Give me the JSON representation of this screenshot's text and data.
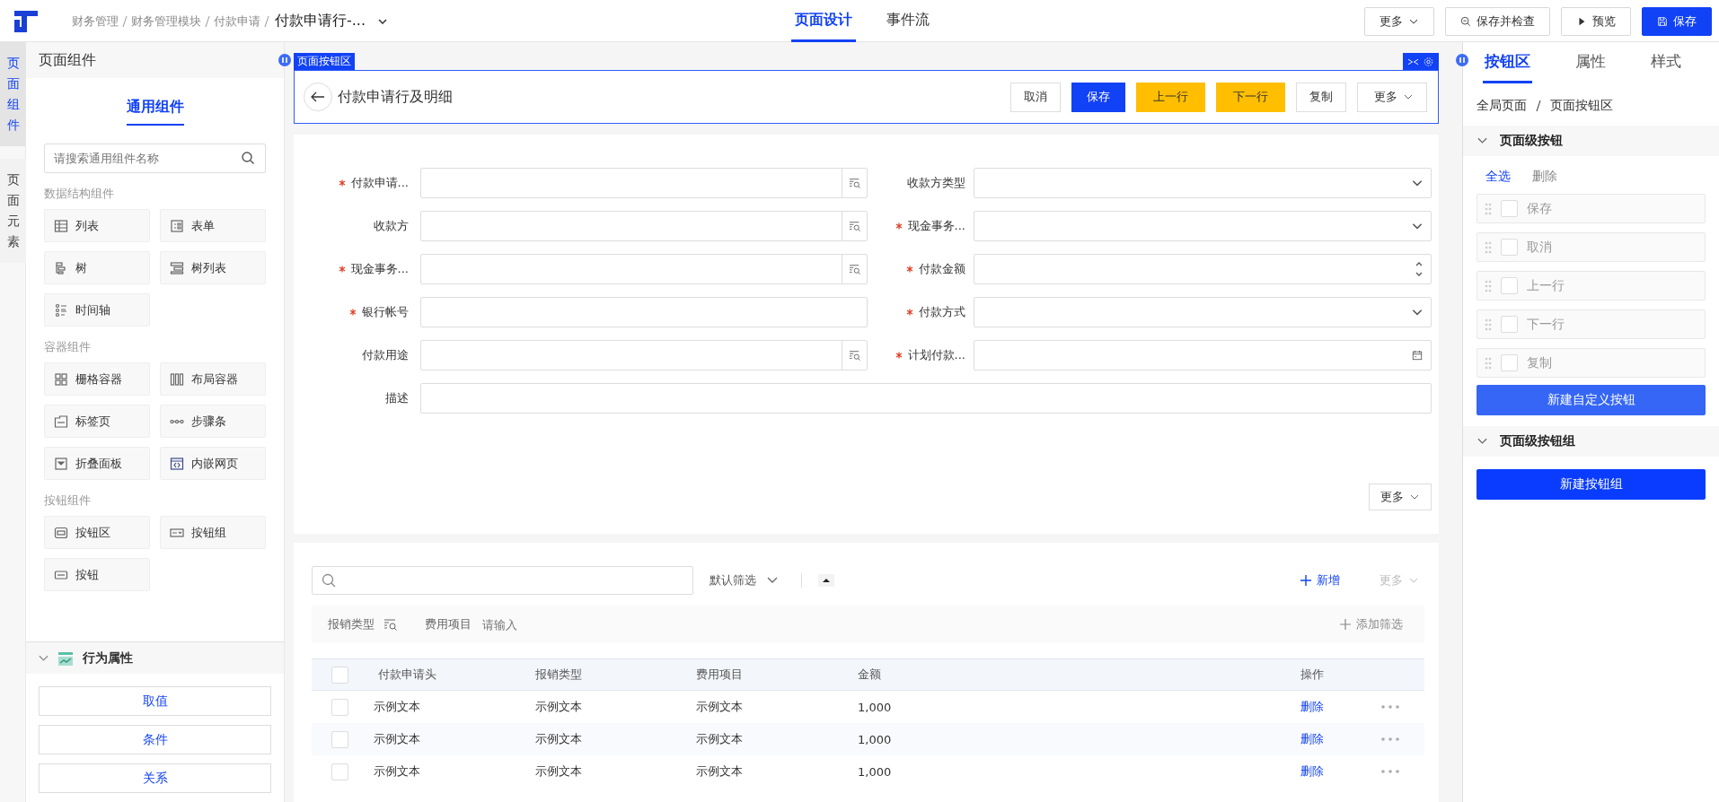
{
  "topbar": {
    "breadcrumbs": [
      "财务管理",
      "财务管理模块",
      "付款申请"
    ],
    "current": "付款申请行-...",
    "tabs": [
      {
        "label": "页面设计",
        "selected": true
      },
      {
        "label": "事件流",
        "selected": false
      }
    ],
    "actions": [
      {
        "label": "更多",
        "kind": "dropdown"
      },
      {
        "label": "保存并检查",
        "kind": "check"
      },
      {
        "label": "预览",
        "kind": "preview"
      },
      {
        "label": "保存",
        "kind": "primary"
      }
    ]
  },
  "side_tabs": [
    {
      "label": "页面组件",
      "selected": true
    },
    {
      "label": "页面元素",
      "selected": false
    }
  ],
  "components_panel": {
    "title": "页面组件",
    "tab": "通用组件",
    "search": {
      "placeholder": "请搜索通用组件名称"
    },
    "groups": [
      {
        "title": "数据结构组件",
        "items": [
          {
            "label": "列表",
            "kind": "table"
          },
          {
            "label": "表单",
            "kind": "form"
          },
          {
            "label": "树",
            "kind": "tree"
          },
          {
            "label": "树列表",
            "kind": "treelist"
          },
          {
            "label": "时间轴",
            "kind": "timeline"
          }
        ]
      },
      {
        "title": "容器组件",
        "items": [
          {
            "label": "栅格容器",
            "kind": "grid"
          },
          {
            "label": "布局容器",
            "kind": "layout"
          },
          {
            "label": "标签页",
            "kind": "tabs"
          },
          {
            "label": "步骤条",
            "kind": "steps"
          },
          {
            "label": "折叠面板",
            "kind": "collapse"
          },
          {
            "label": "内嵌网页",
            "kind": "iframe"
          }
        ]
      },
      {
        "title": "按钮组件",
        "items": [
          {
            "label": "按钮区",
            "kind": "buttonarea"
          },
          {
            "label": "按钮组",
            "kind": "buttongroup"
          },
          {
            "label": "按钮",
            "kind": "button"
          }
        ]
      }
    ]
  },
  "behavior": {
    "title": "行为属性",
    "expanded": true,
    "buttons": [
      "取值",
      "条件",
      "关系"
    ]
  },
  "button_area": {
    "tag": "页面按钮区",
    "title": "付款申请行及明细",
    "buttons": [
      {
        "label": "取消",
        "kind": "default"
      },
      {
        "label": "保存",
        "kind": "primary"
      },
      {
        "label": "上一行",
        "kind": "warning"
      },
      {
        "label": "下一行",
        "kind": "warning"
      },
      {
        "label": "复制",
        "kind": "default"
      },
      {
        "label": "更多",
        "kind": "dropdown"
      }
    ]
  },
  "form": {
    "fields": [
      {
        "label": "付款申请...",
        "required": true,
        "kind": "lookup"
      },
      {
        "label": "收款方类型",
        "required": false,
        "kind": "select"
      },
      {
        "label": "收款方",
        "required": false,
        "kind": "lookup"
      },
      {
        "label": "现金事务...",
        "required": true,
        "kind": "select"
      },
      {
        "label": "现金事务...",
        "required": true,
        "kind": "lookup"
      },
      {
        "label": "付款金额",
        "required": true,
        "kind": "number"
      },
      {
        "label": "银行帐号",
        "required": true,
        "kind": "text"
      },
      {
        "label": "付款方式",
        "required": true,
        "kind": "select"
      },
      {
        "label": "付款用途",
        "required": false,
        "kind": "lookup"
      },
      {
        "label": "计划付款...",
        "required": true,
        "kind": "date"
      },
      {
        "label": "描述",
        "required": false,
        "kind": "wide"
      }
    ],
    "more": "更多"
  },
  "table_section": {
    "filter": "默认筛选",
    "add": "新增",
    "more": {
      "label": "更多",
      "disabled": true
    },
    "filters": [
      {
        "label": "报销类型",
        "kind": "lookup"
      },
      {
        "label": "费用项目",
        "kind": "input",
        "placeholder": "请输入"
      }
    ],
    "add_filter": "添加筛选",
    "header_checked": false,
    "columns": [
      "付款申请头",
      "报销类型",
      "费用项目",
      "金额",
      "操作"
    ],
    "rows": [
      {
        "checked": false,
        "cells": [
          "示例文本",
          "示例文本",
          "示例文本",
          "1,000"
        ],
        "action": "删除"
      },
      {
        "checked": false,
        "cells": [
          "示例文本",
          "示例文本",
          "示例文本",
          "1,000"
        ],
        "action": "删除"
      },
      {
        "checked": false,
        "cells": [
          "示例文本",
          "示例文本",
          "示例文本",
          "1,000"
        ],
        "action": "删除"
      }
    ]
  },
  "right_panel": {
    "tabs": [
      {
        "label": "按钮区",
        "selected": true
      },
      {
        "label": "属性",
        "selected": false
      },
      {
        "label": "样式",
        "selected": false
      }
    ],
    "breadcrumb": [
      "全局页面",
      "页面按钮区"
    ],
    "buttons_section": {
      "title": "页面级按钮",
      "expanded": true,
      "select_all": "全选",
      "delete": "删除",
      "items": [
        {
          "label": "保存",
          "checked": false
        },
        {
          "label": "取消",
          "checked": false
        },
        {
          "label": "上一行",
          "checked": false
        },
        {
          "label": "下一行",
          "checked": false
        },
        {
          "label": "复制",
          "checked": false
        }
      ],
      "new_button": "新建自定义按钮"
    },
    "groups_section": {
      "title": "页面级按钮组",
      "expanded": true,
      "new_button": "新建按钮组"
    }
  }
}
